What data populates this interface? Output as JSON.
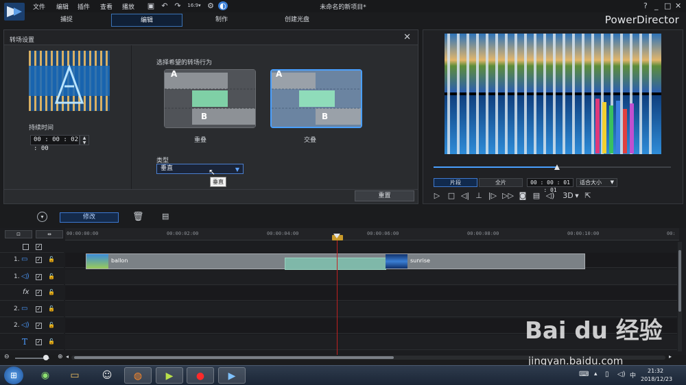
{
  "app": {
    "menu": [
      "文件",
      "编辑",
      "插件",
      "查看",
      "播放"
    ],
    "window_title": "未命名的新项目*",
    "brand": "PowerDirector",
    "window_controls": [
      "?",
      "_",
      "□",
      "✕"
    ]
  },
  "main_tabs": [
    {
      "label": "捕捉",
      "active": false
    },
    {
      "label": "编辑",
      "active": true
    },
    {
      "label": "制作",
      "active": false
    },
    {
      "label": "创建光盘",
      "active": false
    }
  ],
  "dialog": {
    "title": "转场设置",
    "duration_label": "持续时间",
    "duration_value": "00 : 00 : 02 : 00",
    "behavior_label": "选择希望的转场行为",
    "options": [
      {
        "label": "重叠",
        "selected": false
      },
      {
        "label": "交叠",
        "selected": true
      }
    ],
    "letters": {
      "a": "A",
      "b": "B"
    },
    "type_label": "类型",
    "type_value": "垂直",
    "tooltip": "垂直",
    "reset_label": "重置"
  },
  "preview": {
    "clip_tab": "片段",
    "movie_tab": "全片",
    "timecode": "00 : 00 : 01 : 01",
    "fit_label": "适合大小",
    "scrub_progress": 0.52,
    "three_d": "3D"
  },
  "toolbar": {
    "modify_label": "修改"
  },
  "timeline": {
    "ticks": [
      "00:00:00:00",
      "00:00:02:00",
      "00:00:04:00",
      "00:00:06:00",
      "00:00:08:00",
      "00:00:10:00",
      "00:"
    ],
    "tracks": [
      {
        "num": "1.",
        "kind": "video"
      },
      {
        "num": "1.",
        "kind": "audio"
      },
      {
        "num": "",
        "kind": "fx"
      },
      {
        "num": "2.",
        "kind": "video"
      },
      {
        "num": "2.",
        "kind": "audio"
      },
      {
        "num": "",
        "kind": "title"
      }
    ],
    "clips": {
      "first": "ballon",
      "second": "sunrise"
    }
  },
  "taskbar": {
    "time": "21:32",
    "date": "2018/12/23"
  },
  "watermark": {
    "text": "Bai du 经验",
    "sub": "jingyan.baidu.com"
  }
}
